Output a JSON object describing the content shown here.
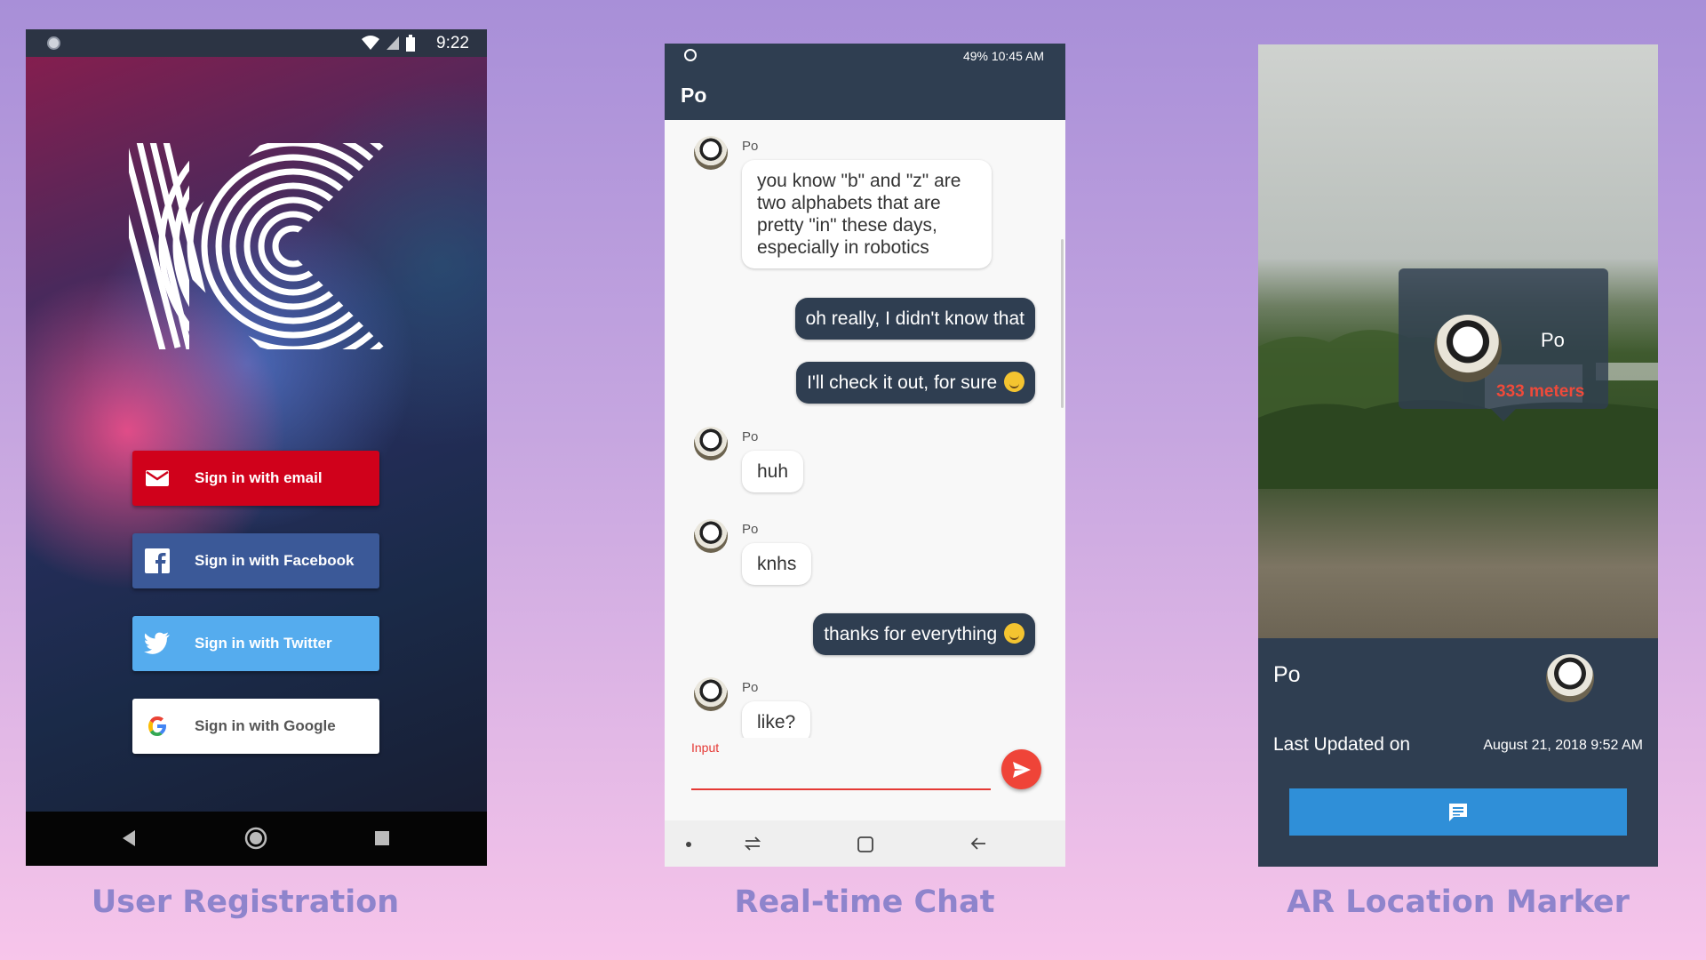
{
  "captions": {
    "registration": "User Registration",
    "chat": "Real-time Chat",
    "ar": "AR Location Marker"
  },
  "registration": {
    "status_time": "9:22",
    "logo_icon": "k-logo",
    "buttons": [
      {
        "label": "Sign in with email",
        "icon": "mail-icon",
        "color": "#d0011b"
      },
      {
        "label": "Sign in with Facebook",
        "icon": "facebook-icon",
        "color": "#3b5998"
      },
      {
        "label": "Sign in with Twitter",
        "icon": "twitter-icon",
        "color": "#55acee"
      },
      {
        "label": "Sign in with Google",
        "icon": "google-icon",
        "color": "#ffffff"
      }
    ]
  },
  "chat": {
    "status": "49%  10:45 AM",
    "title": "Po",
    "messages": [
      {
        "dir": "in",
        "sender": "Po",
        "text": "you know \"b\" and \"z\" are two alphabets that are pretty \"in\" these days, especially in robotics"
      },
      {
        "dir": "out",
        "text": "oh really, I didn't know that"
      },
      {
        "dir": "out",
        "text": "I'll check it out, for sure"
      },
      {
        "dir": "in",
        "sender": "Po",
        "text": "huh"
      },
      {
        "dir": "in",
        "sender": "Po",
        "text": "knhs"
      },
      {
        "dir": "out",
        "text": "thanks for everything"
      },
      {
        "dir": "in",
        "sender": "Po",
        "text": "like?"
      }
    ],
    "input_label": "Input"
  },
  "ar": {
    "card_name": "Po",
    "card_distance": "333 meters",
    "name": "Po",
    "last_updated_label": "Last Updated on",
    "last_updated_value": "August 21, 2018 9:52 AM",
    "accent": "#2f8fd8"
  }
}
